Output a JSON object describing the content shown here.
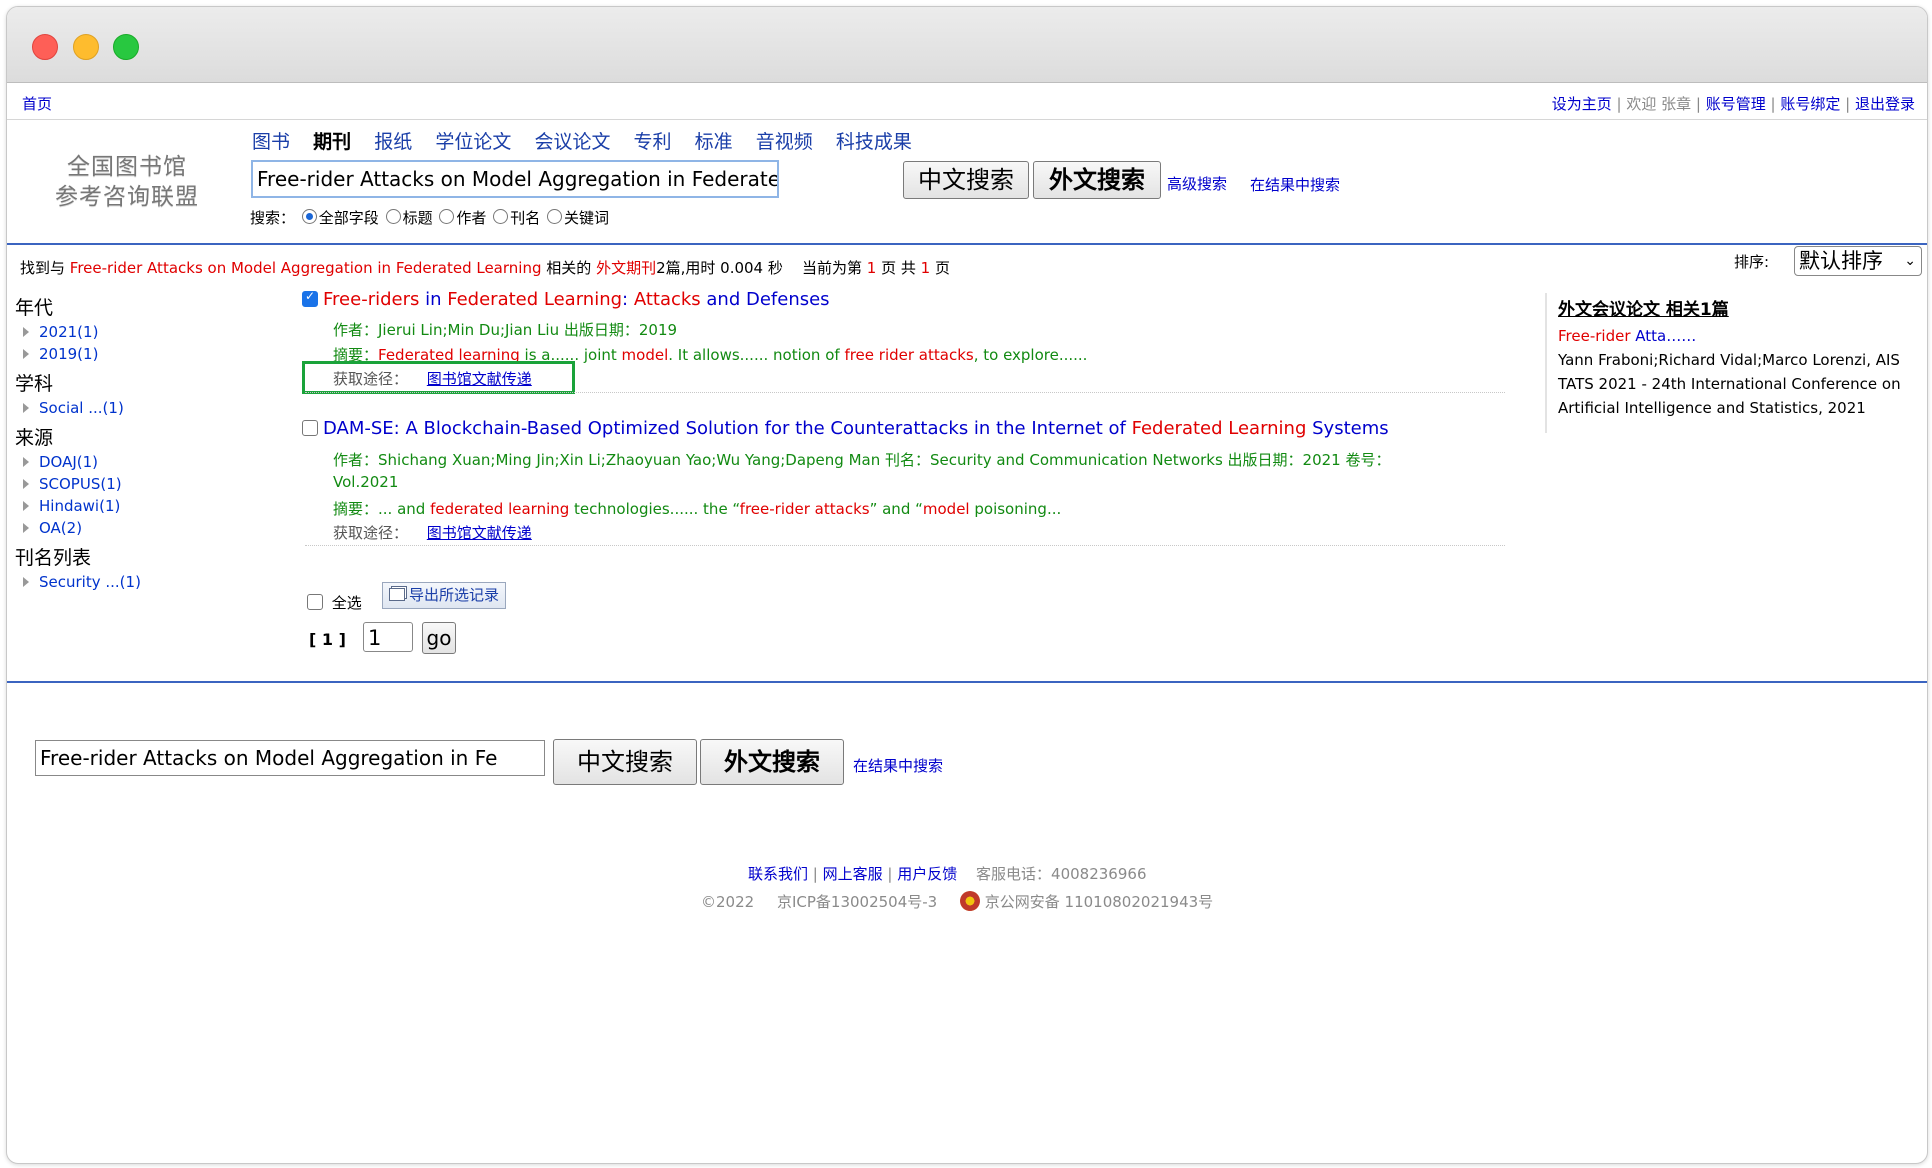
{
  "topbar": {
    "home": "首页",
    "set_home": "设为主页",
    "welcome": "欢迎 张章",
    "account_manage": "账号管理",
    "account_bind": "账号绑定",
    "logout": "退出登录"
  },
  "logo": {
    "line1": "全国图书馆",
    "line2": "参考咨询联盟"
  },
  "nav_tabs": [
    "图书",
    "期刊",
    "报纸",
    "学位论文",
    "会议论文",
    "专利",
    "标准",
    "音视频",
    "科技成果"
  ],
  "search": {
    "query": "Free-rider Attacks on Model Aggregation in Federated Learning",
    "btn_cn": "中文搜索",
    "btn_foreign": "外文搜索",
    "advanced": "高级搜索",
    "in_results": "在结果中搜索",
    "field_label": "搜索：",
    "fields": [
      "全部字段",
      "标题",
      "作者",
      "刊名",
      "关键词"
    ]
  },
  "summary": {
    "prefix": "找到与",
    "query": "Free-rider Attacks on Model Aggregation in Federated Learning",
    "related": "相关的",
    "category": "外文期刊",
    "count_text": "2篇,用时 0.004 秒",
    "page_prefix": "当前为第",
    "page_num": "1",
    "page_mid": "页 共",
    "total_pages": "1",
    "page_suffix": "页"
  },
  "sort": {
    "label": "排序:",
    "value": "默认排序"
  },
  "sidebar": {
    "year_head": "年代",
    "years": [
      "2021(1)",
      "2019(1)"
    ],
    "subject_head": "学科",
    "subjects": [
      "Social ...(1)"
    ],
    "source_head": "来源",
    "sources": [
      "DOAJ(1)",
      "SCOPUS(1)",
      "Hindawi(1)",
      "OA(2)"
    ],
    "journal_head": "刊名列表",
    "journals": [
      "Security ...(1)"
    ]
  },
  "results": [
    {
      "title_parts": [
        {
          "t": "Free-riders",
          "c": "red"
        },
        {
          "t": " in ",
          "c": "blue"
        },
        {
          "t": "Federated Learning",
          "c": "red"
        },
        {
          "t": ": ",
          "c": "blue"
        },
        {
          "t": "Attacks",
          "c": "red"
        },
        {
          "t": " and Defenses",
          "c": "blue"
        }
      ],
      "meta": "作者：Jierui Lin;Min Du;Jian Liu 出版日期：2019",
      "abstract_parts": [
        {
          "t": "摘要：",
          "c": "green"
        },
        {
          "t": "Federated learning",
          "c": "red"
        },
        {
          "t": " is a...... joint ",
          "c": "green"
        },
        {
          "t": "model",
          "c": "red"
        },
        {
          "t": ". It allows...... notion of ",
          "c": "green"
        },
        {
          "t": "free rider attacks",
          "c": "red"
        },
        {
          "t": ", to explore......",
          "c": "green"
        }
      ],
      "access_label": "获取途径：",
      "access_link": "图书馆文献传递"
    },
    {
      "title_parts": [
        {
          "t": "DAM-SE: A Blockchain-Based Optimized Solution for the Counterattacks in the Internet of ",
          "c": "blue"
        },
        {
          "t": "Federated Learning",
          "c": "red"
        },
        {
          "t": " Systems",
          "c": "blue"
        }
      ],
      "meta_line1": "作者：Shichang Xuan;Ming Jin;Xin Li;Zhaoyuan Yao;Wu Yang;Dapeng Man 刊名：Security and Communication Networks 出版日期：2021 卷号：",
      "meta_line2": "Vol.2021",
      "abstract_parts": [
        {
          "t": "摘要：... and ",
          "c": "green"
        },
        {
          "t": "federated learning",
          "c": "red"
        },
        {
          "t": " technologies...... the “",
          "c": "green"
        },
        {
          "t": "free-rider attacks",
          "c": "red"
        },
        {
          "t": "” and “",
          "c": "green"
        },
        {
          "t": "model",
          "c": "red"
        },
        {
          "t": " poisoning...",
          "c": "green"
        }
      ],
      "access_label": "获取途径：",
      "access_link": "图书馆文献传递"
    }
  ],
  "bulk": {
    "select_all": "全选",
    "export": "导出所选记录"
  },
  "pager": {
    "pages": "[ 1 ]",
    "input": "1",
    "go": "go"
  },
  "related_panel": {
    "heading": "外文会议论文 相关1篇",
    "title_red": "Free-rider",
    "title_blue": " Atta……",
    "detail": "Yann Fraboni;Richard Vidal;Marco Lorenzi, AIS TATS 2021 - 24th International Conference on Artificial Intelligence and Statistics, 2021"
  },
  "bottom_search": {
    "query": "Free-rider Attacks on Model Aggregation in Fe",
    "btn_cn": "中文搜索",
    "btn_foreign": "外文搜索",
    "in_results": "在结果中搜索"
  },
  "footer": {
    "contact": "联系我们",
    "online_service": "网上客服",
    "feedback": "用户反馈",
    "phone": "客服电话：4008236966",
    "copyright": "©2022",
    "icp": "京ICP备13002504号-3",
    "police": "京公网安备 11010802021943号"
  },
  "colors": {
    "accent_blue": "#0000cc",
    "highlight_red": "#e00000",
    "meta_green": "#128a12",
    "rule_blue": "#3b64c0",
    "annotation_box": "#1aa33a"
  }
}
